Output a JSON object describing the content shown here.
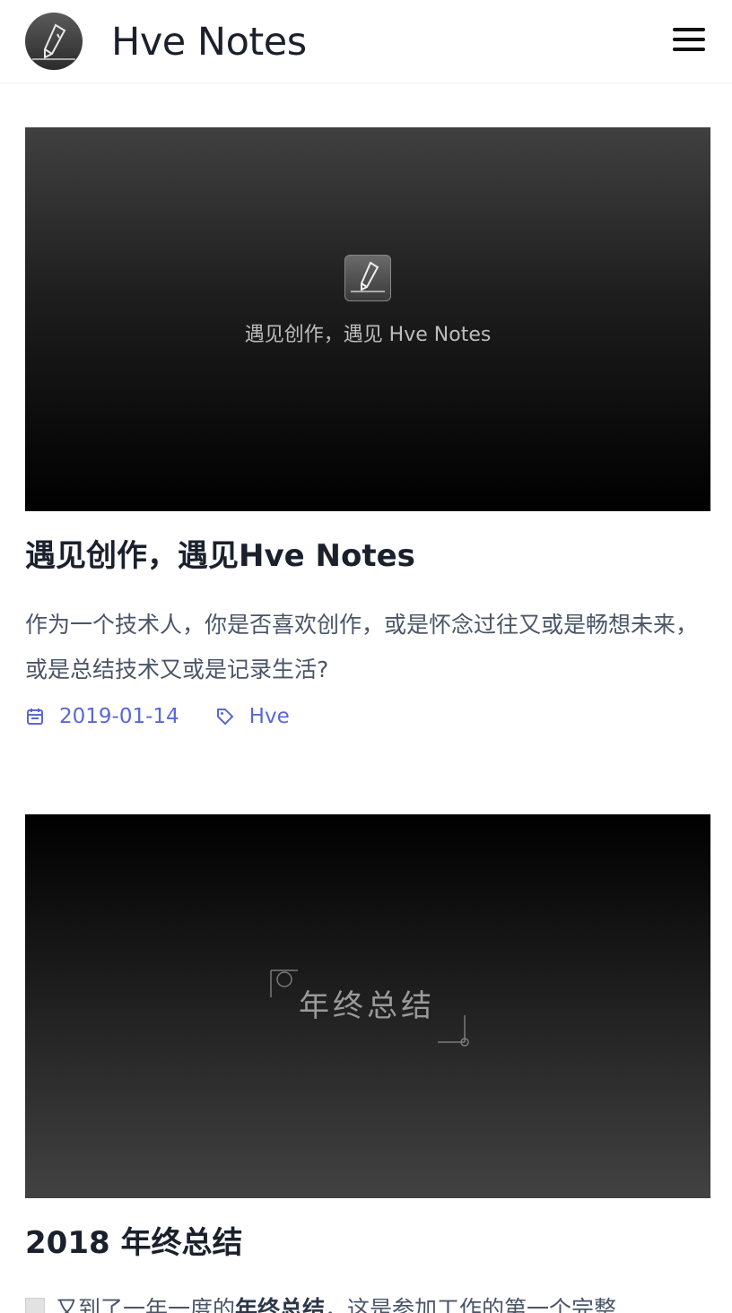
{
  "header": {
    "site_title": "Hve Notes",
    "logo_icon": "pen-logo-icon",
    "menu_icon": "hamburger-menu-icon"
  },
  "posts": [
    {
      "cover_caption": "遇见创作，遇见 Hve Notes",
      "title": "遇见创作，遇见Hve Notes",
      "abstract": "作为一个技术人，你是否喜欢创作，或是怀念过往又或是畅想未来，或是总结技术又或是记录生活?",
      "date": "2019-01-14",
      "tag": "Hve"
    },
    {
      "cover_caption": "年终总结",
      "title": "2018 年终总结",
      "excerpt_pre": "又到了一年一度的",
      "excerpt_bold": "年终总结",
      "excerpt_post": "，这是参加工作的第一个完整"
    }
  ],
  "colors": {
    "accent": "#5a67d8",
    "text": "#1a202c",
    "muted": "#4a5568"
  }
}
